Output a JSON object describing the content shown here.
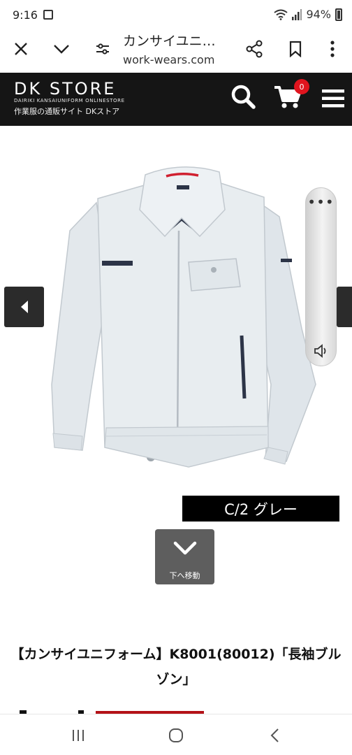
{
  "status": {
    "time": "9:16",
    "battery": "94%"
  },
  "browser": {
    "page_title": "カンサイユニ…",
    "host": "work-wears.com"
  },
  "store": {
    "logo": "DK STORE",
    "logo_sub": "DAIRIKI KANSAIUNIFORM ONLINESTORE",
    "tagline": "作業服の通販サイト DKストア",
    "cart_count": "0",
    "accent_color": "#e0141e"
  },
  "gallery": {
    "color_label": "C/2 グレー",
    "scroll_down_label": "下へ移動"
  },
  "product": {
    "title": "【カンサイユニフォーム】K8001(80012)「長袖ブルゾン」"
  },
  "icons": {
    "close": "close-icon",
    "down": "chevron-down-icon",
    "tune": "page-options-icon",
    "share": "share-icon",
    "bookmark": "bookmark-icon",
    "more": "more-vert-icon",
    "search": "search-icon",
    "cart": "cart-icon",
    "menu": "hamburger-icon"
  }
}
